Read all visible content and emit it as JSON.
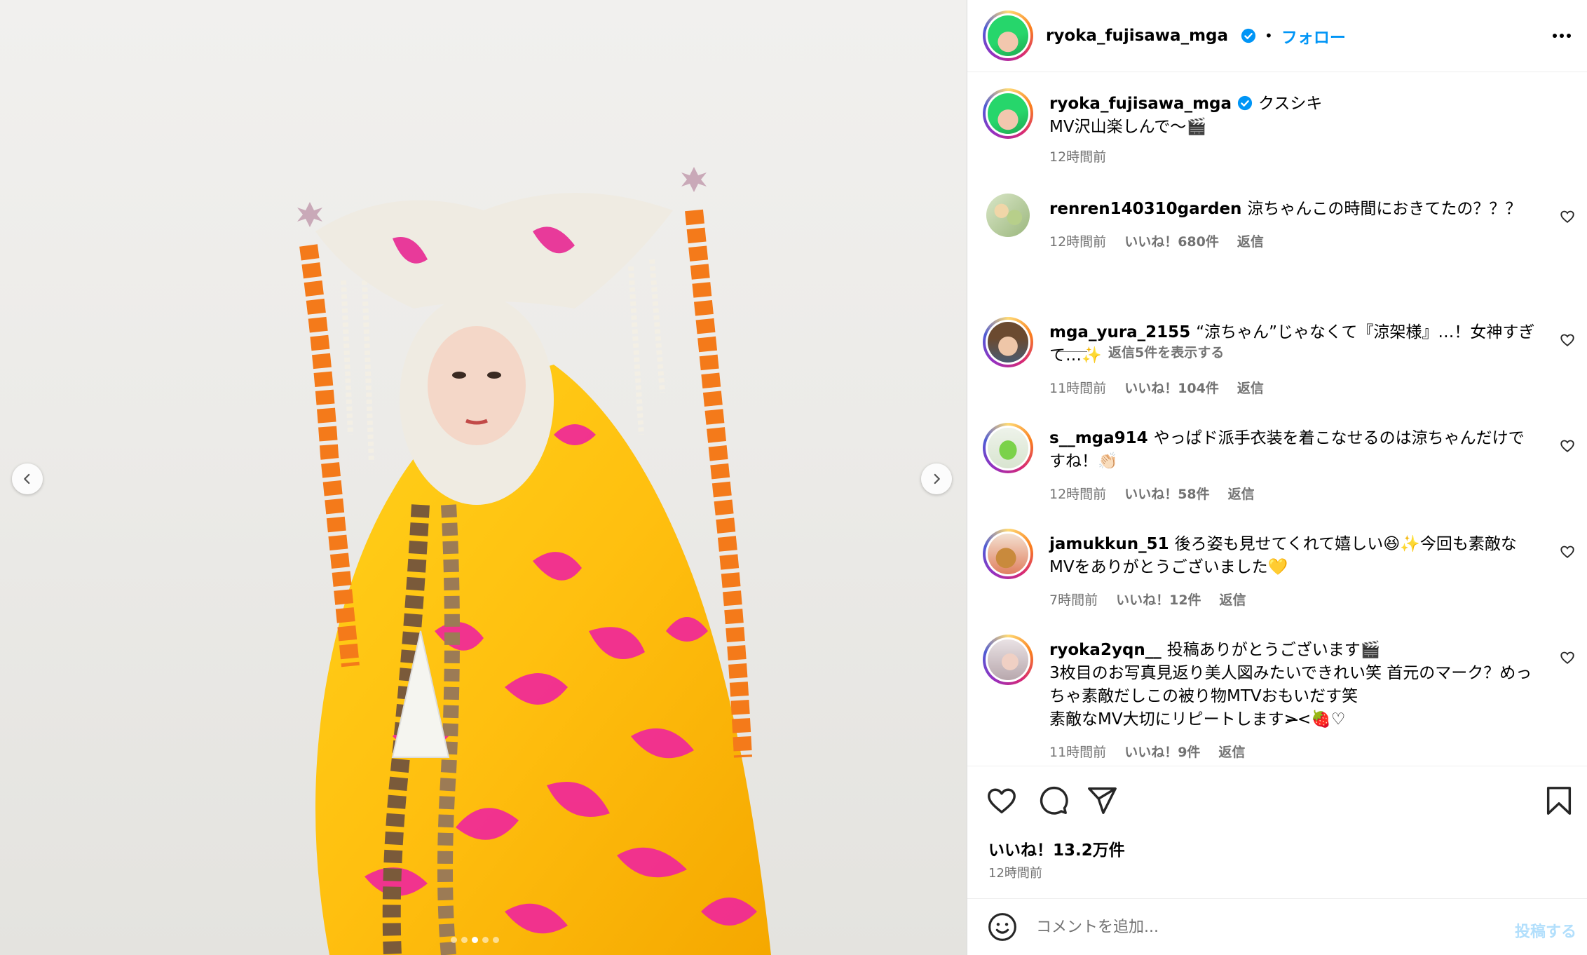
{
  "header": {
    "username": "ryoka_fujisawa_mga",
    "separator": "•",
    "follow_label": "フォロー"
  },
  "caption": {
    "username": "ryoka_fujisawa_mga",
    "title": "クスシキ",
    "text": "MV沢山楽しんで〜",
    "emoji": "🎬",
    "time": "12時間前"
  },
  "comments": [
    {
      "username": "renren140310garden",
      "text": "涼ちゃんこの時間におきてたの？？？",
      "time": "12時間前",
      "likes": "いいね！680件",
      "reply": "返信",
      "view_replies": "返信5件を表示する"
    },
    {
      "username": "mga_yura_2155",
      "text": "“涼ちゃん”じゃなくて『涼架様』…！女神すぎて…✨",
      "time": "11時間前",
      "likes": "いいね！104件",
      "reply": "返信"
    },
    {
      "username": "s__mga914",
      "text": "やっぱド派手衣装を着こなせるのは涼ちゃんだけですね！👏🏻",
      "time": "12時間前",
      "likes": "いいね！58件",
      "reply": "返信"
    },
    {
      "username": "jamukkun_51",
      "text": "後ろ姿も見せてくれて嬉しい😆✨今回も素敵なMVをありがとうございました💛",
      "time": "7時間前",
      "likes": "いいね！12件",
      "reply": "返信"
    },
    {
      "username": "ryoka2yqn__",
      "text": "投稿ありがとうございます🎬",
      "text_lines": [
        "3枚目のお写真見返り美人図みたいできれい笑 首元のマーク？めっちゃ素敵だしこの被り物MTVおもいだす笑",
        "素敵なMV大切にリピートします>̶̶̶<🍓♡"
      ],
      "time": "11時間前",
      "likes": "いいね！9件",
      "reply": "返信"
    }
  ],
  "footer": {
    "likes": "いいね！13.2万件",
    "time": "12時間前",
    "comment_placeholder": "コメントを追加...",
    "post_label": "投稿する"
  },
  "carousel": {
    "total_slides": 5,
    "active_slide": 3
  },
  "colors": {
    "link_blue": "#0095f6",
    "verified_blue": "#0095f6",
    "secondary_text": "#737373",
    "post_disabled": "#b2dffc"
  },
  "icons": [
    "verified-icon",
    "more-options-icon",
    "heart-icon",
    "comment-icon",
    "share-icon",
    "bookmark-icon",
    "emoji-icon",
    "chevron-left-icon",
    "chevron-right-icon"
  ]
}
